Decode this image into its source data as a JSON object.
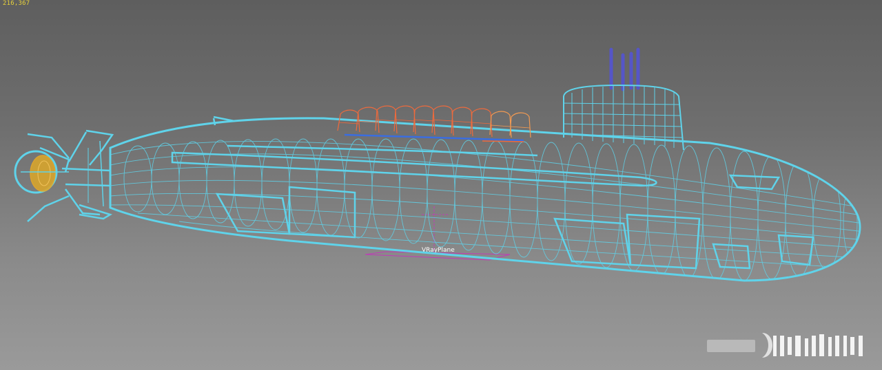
{
  "viewport": {
    "coordinate_readout": "216,367",
    "background_colors": {
      "top": "#5e5e5e",
      "bottom": "#9a9a9a"
    }
  },
  "scene": {
    "object_labels": {
      "vray_plane": "VRayPlane"
    },
    "colors": {
      "hull_wireframe": "#5fd3ea",
      "missile_tubes_wireframe": "#ef6a3c",
      "missile_tubes_light": "#f29a52",
      "periscopes": "#5555c8",
      "propeller": "#e6a82a",
      "vray_plane": "#c03ab8"
    }
  },
  "watermark": {
    "icon_name": "watermark-logo-icon"
  }
}
